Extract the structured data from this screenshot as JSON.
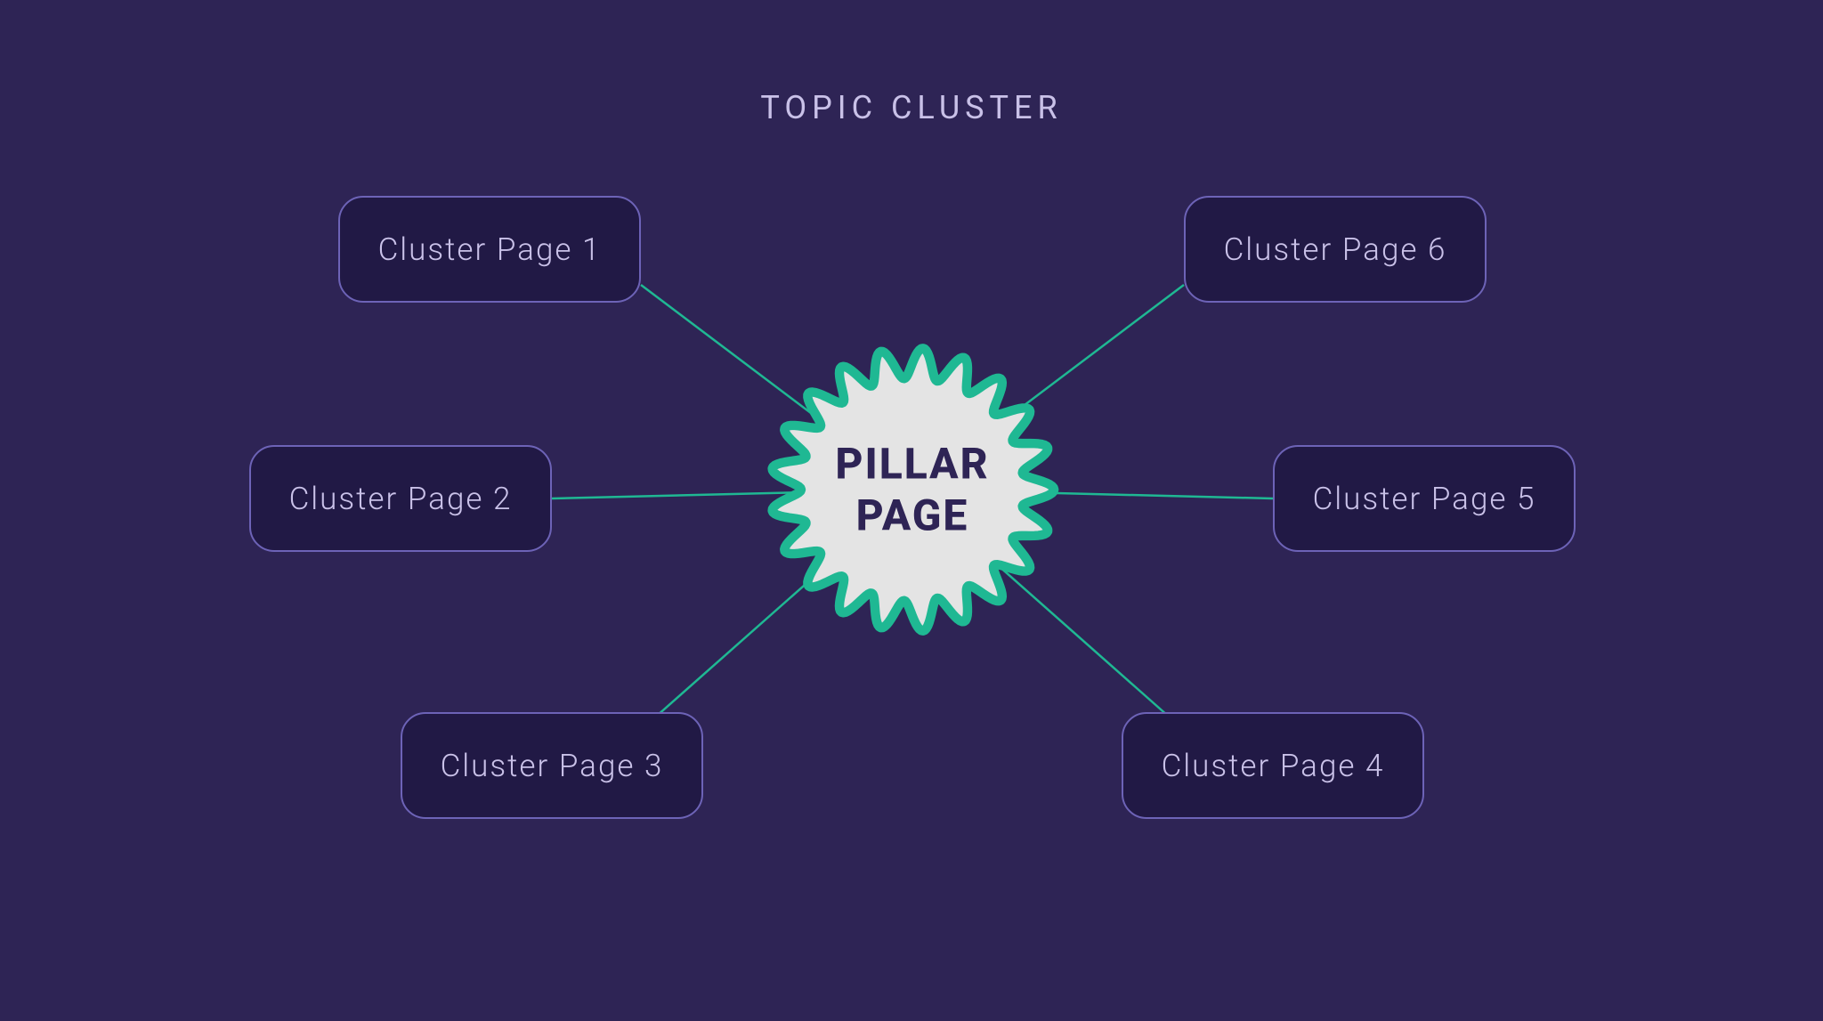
{
  "title": "TOPIC CLUSTER",
  "center": {
    "label": "PILLAR\nPAGE"
  },
  "nodes": [
    {
      "label": "Cluster Page 1"
    },
    {
      "label": "Cluster Page 2"
    },
    {
      "label": "Cluster Page 3"
    },
    {
      "label": "Cluster Page 4"
    },
    {
      "label": "Cluster Page 5"
    },
    {
      "label": "Cluster Page 6"
    }
  ],
  "colors": {
    "background": "#2e2455",
    "nodeBorder": "#6d63b7",
    "nodeFill": "#211945",
    "text": "#c9c1e8",
    "centerFill": "#e4e4e4",
    "centerStroke": "#1fb893",
    "centerText": "#2e2455",
    "connector": "#1fb893"
  }
}
